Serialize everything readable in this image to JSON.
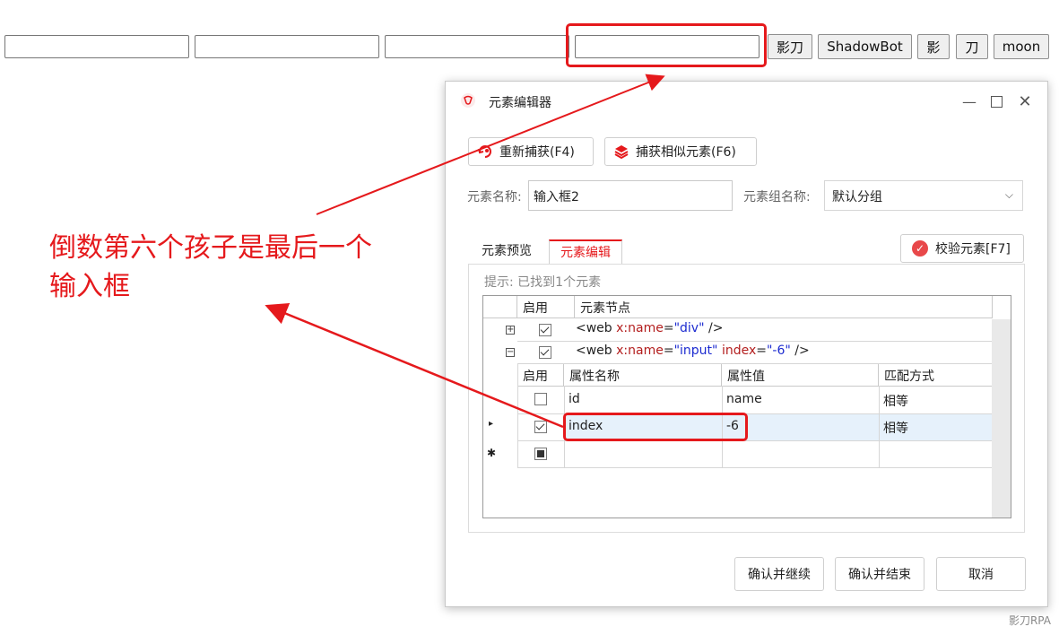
{
  "page": {
    "buttons": [
      "影刀",
      "ShadowBot",
      "影",
      "刀",
      "moon"
    ]
  },
  "annotation": {
    "line1": "倒数第六个孩子是最后一个",
    "line2": "输入框"
  },
  "dialog": {
    "title": "元素编辑器",
    "recapture_label": "重新捕获(F4)",
    "capture_similar_label": "捕获相似元素(F6)",
    "element_name_label": "元素名称:",
    "element_name_value": "输入框2",
    "group_name_label": "元素组名称:",
    "group_name_value": "默认分组",
    "tabs": [
      "元素预览",
      "元素编辑"
    ],
    "active_tab": "元素编辑",
    "verify_label": "校验元素[F7]",
    "hint": "提示: 已找到1个元素",
    "grid": {
      "headers": [
        "启用",
        "元素节点"
      ],
      "nodes": [
        {
          "enabled": true,
          "expanded": false,
          "tag": "<web",
          "attr1": "x:name",
          "val1": "\"div\"",
          "close": " />"
        },
        {
          "enabled": true,
          "expanded": true,
          "tag": "<web",
          "attr1": "x:name",
          "val1": "\"input\"",
          "attr2": "index",
          "val2": "\"-6\"",
          "close": " />"
        }
      ],
      "sub_headers": [
        "启用",
        "属性名称",
        "属性值",
        "匹配方式"
      ],
      "attributes": [
        {
          "enabled": false,
          "name": "id",
          "value": "name",
          "match": "相等"
        },
        {
          "enabled": true,
          "name": "index",
          "value": "-6",
          "match": "相等"
        }
      ]
    },
    "footer": {
      "confirm_continue": "确认并继续",
      "confirm_finish": "确认并结束",
      "cancel": "取消"
    }
  },
  "watermark": "影刀RPA",
  "colors": {
    "annotation_red": "#e5191c",
    "accent": "#e5191c"
  }
}
